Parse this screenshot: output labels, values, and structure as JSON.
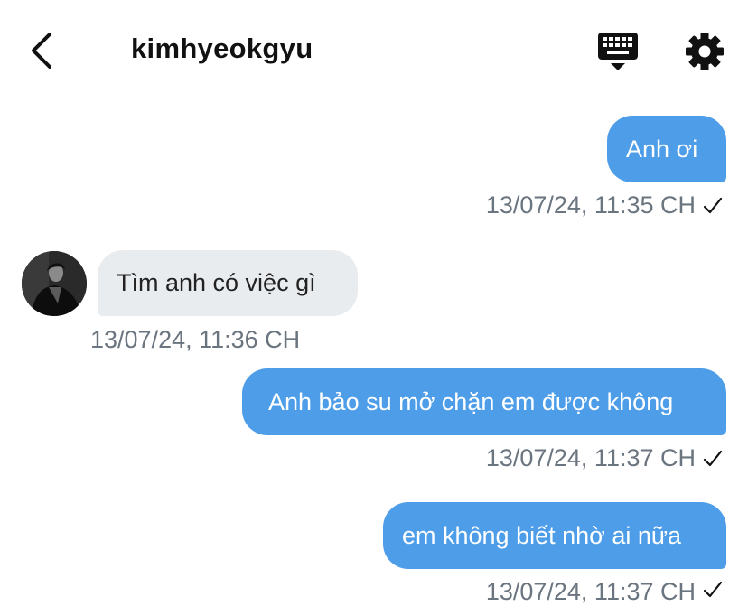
{
  "header": {
    "title": "kimhyeokgyu",
    "back_icon": "chevron-left-icon",
    "keyboard_icon": "keyboard-hide-icon",
    "settings_icon": "gear-icon"
  },
  "colors": {
    "outgoing_bubble": "#4d9de8",
    "incoming_bubble": "#e9ecef",
    "timestamp": "#6b7580"
  },
  "messages": [
    {
      "direction": "outgoing",
      "text": "Anh ơi",
      "timestamp": "13/07/24, 11:35 CH",
      "status_icon": "checkmark-icon"
    },
    {
      "direction": "incoming",
      "text": "Tìm anh có việc gì",
      "timestamp": "13/07/24, 11:36 CH"
    },
    {
      "direction": "outgoing",
      "text": "Anh bảo su mở chặn em được không",
      "timestamp": "13/07/24, 11:37 CH",
      "status_icon": "checkmark-icon"
    },
    {
      "direction": "outgoing",
      "text": "em không biết nhờ ai nữa",
      "timestamp": "13/07/24, 11:37 CH",
      "status_icon": "checkmark-icon"
    }
  ]
}
